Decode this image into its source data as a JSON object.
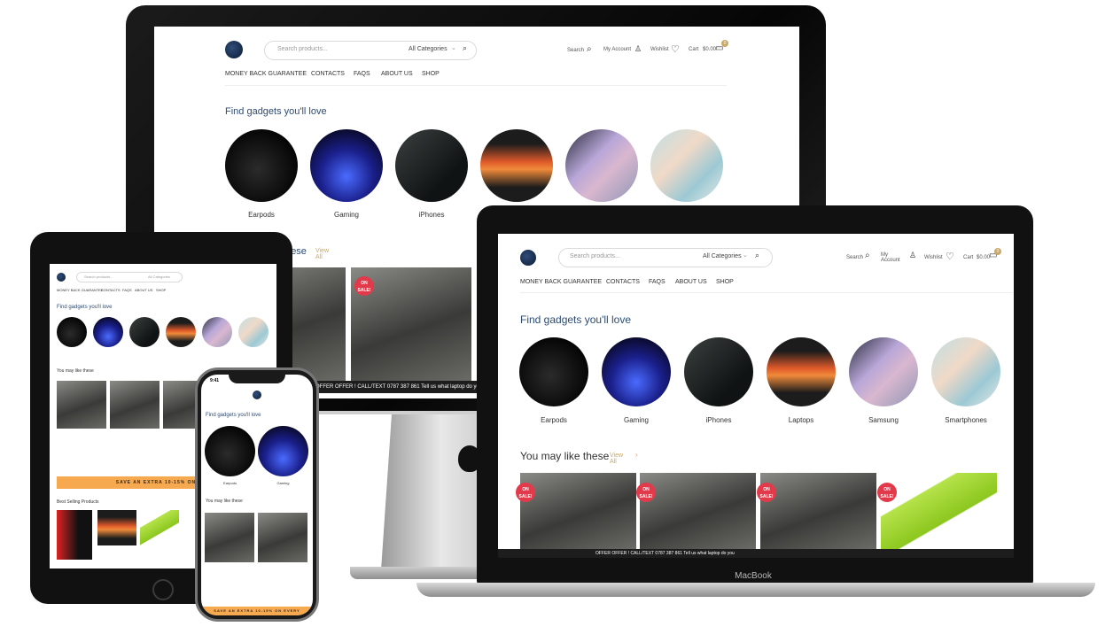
{
  "header": {
    "search_placeholder": "Search products...",
    "categories_select": "All Categories",
    "search_label": "Search",
    "account_label": "My Account",
    "wishlist_label": "Wishlist",
    "cart_label": "Cart",
    "cart_amount": "$0.00",
    "cart_count": "0"
  },
  "nav": [
    "MONEY BACK GUARANTEE",
    "CONTACTS",
    "FAQS",
    "ABOUT US",
    "SHOP"
  ],
  "sections": {
    "gadgets_title": "Find gadgets you'll love",
    "like_title": "You may like these",
    "view_all": "View All",
    "best_selling": "Best Selling Products"
  },
  "categories": [
    {
      "label": "Earpods"
    },
    {
      "label": "Gaming"
    },
    {
      "label": "iPhones"
    },
    {
      "label": "Laptops"
    },
    {
      "label": "Samsung"
    },
    {
      "label": "Smartphones"
    }
  ],
  "badge": "ON SALE!",
  "ticker": "OFFER OFFER ! CALL/TEXT 0787 387 861 Tell us what laptop do you",
  "banner": "SAVE AN EXTRA 10-15% ON EVERY",
  "device_label": "MacBook",
  "phone_time": "9:41"
}
